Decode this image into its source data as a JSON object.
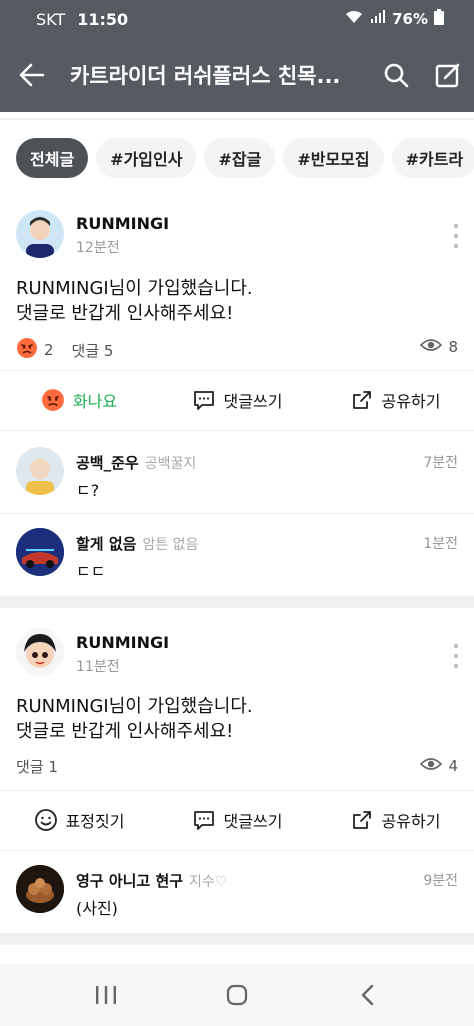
{
  "status": {
    "carrier": "SKT",
    "time": "11:50",
    "battery": "76%"
  },
  "appbar": {
    "title": "카트라이더 러쉬플러스 친목..."
  },
  "chips": [
    "전체글",
    "#가입인사",
    "#잡글",
    "#반모모집",
    "#카트라"
  ],
  "posts": [
    {
      "author": "RUNMINGI",
      "time": "12분전",
      "lines": [
        "RUNMINGI님이 가입했습니다.",
        "댓글로 반갑게 인사해주세요!"
      ],
      "reaction_count": "2",
      "comments_label": "댓글 5",
      "views": "8",
      "actions": [
        "화나요",
        "댓글쓰기",
        "공유하기"
      ]
    },
    {
      "author": "RUNMINGI",
      "time": "11분전",
      "lines": [
        "RUNMINGI님이 가입했습니다.",
        "댓글로 반갑게 인사해주세요!"
      ],
      "comments_label": "댓글 1",
      "views": "4",
      "actions": [
        "표정짓기",
        "댓글쓰기",
        "공유하기"
      ]
    }
  ],
  "comments": [
    {
      "name": "공백_준우",
      "nick": "공백꿀지",
      "time": "7분전",
      "text": "ㄷ?"
    },
    {
      "name": "할게 없음",
      "nick": "암튼 없음",
      "time": "1분전",
      "text": "ㄷㄷ"
    },
    {
      "name": "영구 아니고 현구",
      "nick": "지수♡",
      "time": "9분전",
      "text": "(사진)"
    }
  ],
  "colors": {
    "appbar": "#565b61",
    "accent_green": "#1fae55",
    "chip_active": "#4d5257"
  }
}
